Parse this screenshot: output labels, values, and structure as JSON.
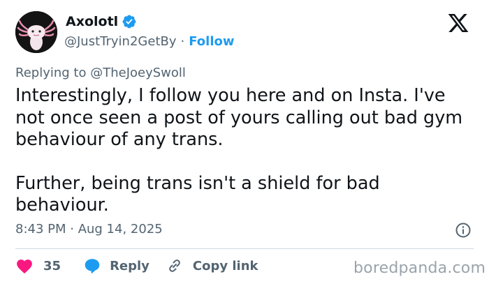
{
  "author": {
    "name": "Axolotl",
    "handle": "@JustTryin2GetBy",
    "separator": "·",
    "follow_label": "Follow",
    "avatar_icon": "axolotl-avatar-icon",
    "verified_icon": "verified-badge-icon"
  },
  "reply_context": {
    "prefix": "Replying to",
    "mention": "@TheJoeySwoll"
  },
  "tweet": {
    "paragraphs": [
      "Interestingly, I follow you here and on Insta. I've not once seen a post of yours calling out bad gym behaviour of any trans.",
      "Further, being trans isn't a shield for bad behaviour."
    ],
    "timestamp": "8:43 PM · Aug 14, 2025"
  },
  "actions": {
    "like_count": "35",
    "reply_label": "Reply",
    "copy_label": "Copy link"
  },
  "watermark": "boredpanda.com",
  "colors": {
    "accent": "#1d9bf0",
    "like": "#f91880",
    "muted": "#536471",
    "text": "#0f1419"
  }
}
